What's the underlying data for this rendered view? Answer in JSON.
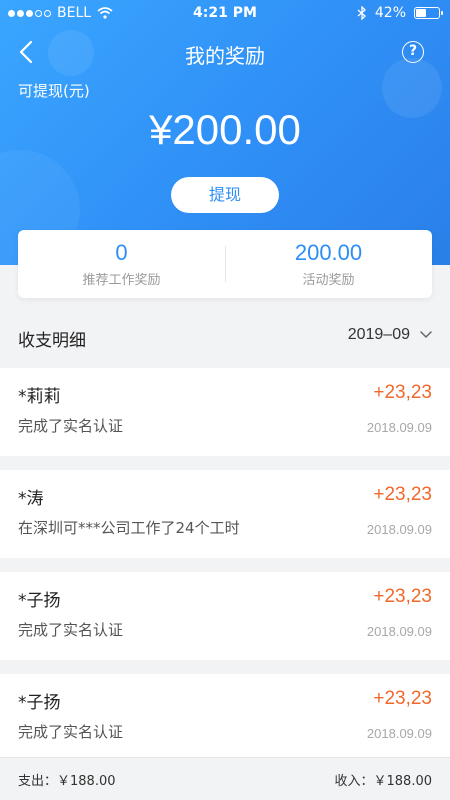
{
  "status_bar": {
    "carrier": "BELL",
    "time": "4:21 PM",
    "battery": "42%",
    "battery_level": 0.42
  },
  "nav": {
    "title": "我的奖励",
    "help": "?"
  },
  "wallet": {
    "withdrawable_label": "可提现(元)",
    "balance": "¥200.00",
    "withdraw_button": "提现"
  },
  "summary": {
    "left": {
      "value": "0",
      "label": "推荐工作奖励"
    },
    "right": {
      "value": "200.00",
      "label": "活动奖励"
    }
  },
  "section": {
    "title": "收支明细",
    "month": "2019–09"
  },
  "records": [
    {
      "name": "*莉莉",
      "desc": "完成了实名认证",
      "amount": "+23,23",
      "date": "2018.09.09"
    },
    {
      "name": "*涛",
      "desc": "在深圳可***公司工作了24个工时",
      "amount": "+23,23",
      "date": "2018.09.09"
    },
    {
      "name": "*子扬",
      "desc": "完成了实名认证",
      "amount": "+23,23",
      "date": "2018.09.09"
    },
    {
      "name": "*子扬",
      "desc": "完成了实名认证",
      "amount": "+23,23",
      "date": "2018.09.09"
    }
  ],
  "footer": {
    "expense": "支出：￥188.00",
    "income": "收入：￥188.00"
  },
  "colors": {
    "primary_blue": "#2d8ef6",
    "amount_orange": "#f0692c",
    "background": "#f2f3f5"
  }
}
